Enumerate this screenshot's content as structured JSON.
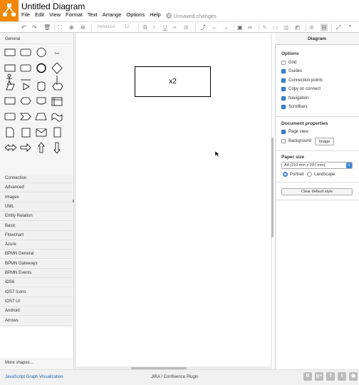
{
  "app": {
    "title": "Untitled Diagram",
    "unsaved": "Unsaved changes"
  },
  "menu": [
    "File",
    "Edit",
    "View",
    "Format",
    "Text",
    "Arrange",
    "Options",
    "Help"
  ],
  "toolbar": {
    "font": "Helvetica",
    "size": "12"
  },
  "sidebar": {
    "general": "General",
    "sections": [
      "Connection",
      "Advanced",
      "Images",
      "UML",
      "Entity Relation",
      "Basic",
      "Flowchart",
      "Azure",
      "BPMN General",
      "BPMN Gateways",
      "BPMN Events",
      "iOS6",
      "iOS7 Icons",
      "iOS7 UI",
      "Android",
      "Arrows"
    ],
    "more": "More shapes...",
    "text_shape": "Text"
  },
  "canvas": {
    "box_text": "x2"
  },
  "format": {
    "header": "Diagram",
    "options_title": "Options",
    "options": [
      {
        "label": "Grid",
        "checked": false
      },
      {
        "label": "Guides",
        "checked": true
      },
      {
        "label": "Connection points",
        "checked": true
      },
      {
        "label": "Copy on connect",
        "checked": true
      },
      {
        "label": "Navigation",
        "checked": true
      },
      {
        "label": "Scrollbars",
        "checked": true
      }
    ],
    "docprops_title": "Document properties",
    "page_view": "Page view",
    "background": "Background",
    "image_btn": "Image",
    "paper_title": "Paper size",
    "paper_value": "A4 (210 mm x 297 mm)",
    "portrait": "Portrait",
    "landscape": "Landscape",
    "clear_btn": "Clear default style"
  },
  "footer": {
    "left": "JavaScript Graph Visualization",
    "center": "JIRA / Confluence Plugin"
  },
  "colors": {
    "accent": "#f08705",
    "check": "#3a84d6"
  }
}
